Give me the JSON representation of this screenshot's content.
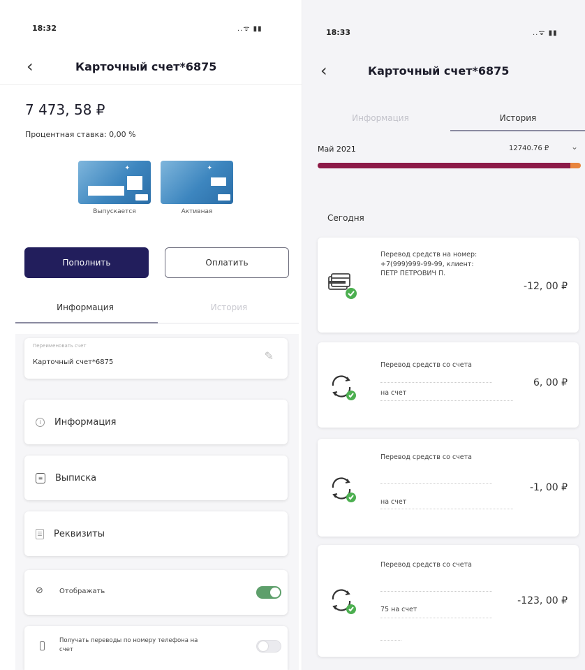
{
  "left": {
    "status": {
      "time": "18:32",
      "icons": "..ᯤ ▮▮"
    },
    "header": {
      "title": "Карточный счет*6875",
      "back_icon": "chevron-left"
    },
    "balance": "7 473, 58 ₽",
    "rate": "Процентная ставка: 0,00 %",
    "cards": [
      {
        "label": "Выпускается"
      },
      {
        "label": "Активная"
      }
    ],
    "actions": {
      "topup": "Пополнить",
      "pay": "Оплатить"
    },
    "tabs": [
      {
        "label": "Информация",
        "active": true
      },
      {
        "label": "История",
        "active": false
      }
    ],
    "rename": {
      "caption": "Переименовать счет",
      "value": "Карточный счет*6875",
      "edit_icon": "pencil"
    },
    "menu": [
      {
        "label": "Информация",
        "icon": "info"
      },
      {
        "label": "Выписка",
        "icon": "document"
      },
      {
        "label": "Реквизиты",
        "icon": "list"
      }
    ],
    "settings": [
      {
        "label": "Отображать",
        "icon": "eye-off",
        "on": true
      },
      {
        "label": "Получать переводы по номеру телефона на счет",
        "icon": "phone",
        "on": false
      }
    ]
  },
  "right": {
    "status": {
      "time": "18:33",
      "icons": "..ᯤ ▮▮"
    },
    "header": {
      "title": "Карточный счет*6875",
      "back_icon": "chevron-left"
    },
    "tabs": [
      {
        "label": "Информация",
        "active": false
      },
      {
        "label": "История",
        "active": true
      }
    ],
    "period": {
      "month": "Май 2021",
      "total": "12740.76 ₽",
      "progress": 0.96
    },
    "section": "Сегодня",
    "transactions": [
      {
        "desc": "Перевод средств на номер: +7(999)999-99-99, клиент: ПЕТР ПЕТРОВИЧ П.",
        "sub": "",
        "amount": "-12, 00 ₽",
        "icon": "wallet-cards"
      },
      {
        "desc": "Перевод средств со счета",
        "sub": "на счет",
        "amount": "6, 00 ₽",
        "icon": "transfer-cycle"
      },
      {
        "desc": "Перевод средств со счета",
        "sub": "на счет",
        "amount": "-1, 00 ₽",
        "icon": "transfer-cycle"
      },
      {
        "desc": "Перевод средств со счета",
        "sub": "75 на счет",
        "amount": "-123, 00 ₽",
        "icon": "transfer-cycle"
      }
    ]
  },
  "colors": {
    "primary": "#221e5c",
    "accent_bar": "#8c1a48",
    "accent_tail": "#e8843c",
    "success": "#4caf50",
    "toggle_on": "#5e9f6b"
  }
}
